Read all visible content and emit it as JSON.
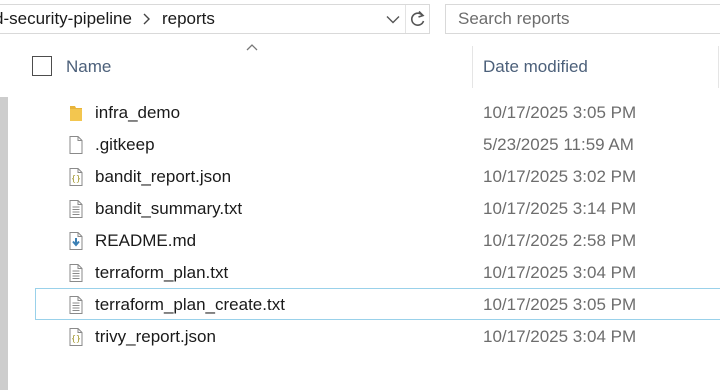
{
  "address_bar": {
    "path": [
      "d-security-pipeline",
      "reports"
    ],
    "dropdown_icon": "chevron-down-icon",
    "refresh_icon": "refresh-icon"
  },
  "search": {
    "placeholder": "Search reports"
  },
  "columns": {
    "name": "Name",
    "date_modified": "Date modified",
    "sorted_by": "Name",
    "sort_direction": "ascending"
  },
  "files": [
    {
      "name": "infra_demo",
      "date": "10/17/2025 3:05 PM",
      "icon": "folder-icon"
    },
    {
      "name": ".gitkeep",
      "date": "5/23/2025 11:59 AM",
      "icon": "blank-file-icon"
    },
    {
      "name": "bandit_report.json",
      "date": "10/17/2025 3:02 PM",
      "icon": "json-file-icon"
    },
    {
      "name": "bandit_summary.txt",
      "date": "10/17/2025 3:14 PM",
      "icon": "text-file-icon"
    },
    {
      "name": "README.md",
      "date": "10/17/2025 2:58 PM",
      "icon": "markdown-file-icon"
    },
    {
      "name": "terraform_plan.txt",
      "date": "10/17/2025 3:04 PM",
      "icon": "text-file-icon"
    },
    {
      "name": "terraform_plan_create.txt",
      "date": "10/17/2025 3:05 PM",
      "icon": "text-file-icon",
      "focused": true
    },
    {
      "name": "trivy_report.json",
      "date": "10/17/2025 3:04 PM",
      "icon": "json-file-icon"
    }
  ],
  "colors": {
    "header_text": "#4c607a",
    "date_text": "#6d6d6d",
    "focus_border": "#99d1ea",
    "folder": "#f3c64f"
  }
}
